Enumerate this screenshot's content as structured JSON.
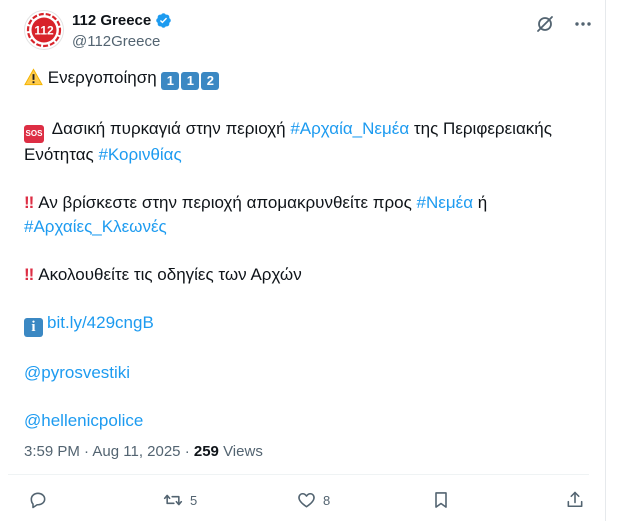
{
  "account": {
    "display_name": "112 Greece",
    "handle": "@112Greece",
    "avatar_text": "112"
  },
  "post": {
    "line1_text": "Ενεργοποίηση",
    "line1_keycaps": [
      "1",
      "1",
      "2"
    ],
    "sos_label": "SOS",
    "p2_text_a": "Δασική πυρκαγιά στην περιοχή ",
    "p2_tag1": "#Αρχαία_Νεμέα",
    "p2_text_b": " της Περιφερειακής Ενότητας ",
    "p2_tag2": "#Κορινθίας",
    "bangbang": "‼",
    "p3_text_a": "Αν βρίσκεστε στην περιοχή απομακρυνθείτε προς ",
    "p3_tag1": "#Νεμέα",
    "p3_text_b": " ή ",
    "p3_tag2": "#Αρχαίες_Κλεωνές",
    "p4_text": "Ακολουθείτε τις οδηγίες των Αρχών",
    "info_symbol": "i",
    "p5_link": "bit.ly/429cngB",
    "mention1": "@pyrosvestiki",
    "mention2": "@hellenicpolice"
  },
  "meta": {
    "time": "3:59 PM",
    "separator": " · ",
    "date": "Aug 11, 2025",
    "views_count": "259",
    "views_label": "Views"
  },
  "actions": {
    "retweets": "5",
    "likes": "8"
  },
  "colors": {
    "link": "#1d9bf0",
    "muted": "#536471",
    "text": "#0f1419",
    "verified": "#1d9bf0"
  }
}
